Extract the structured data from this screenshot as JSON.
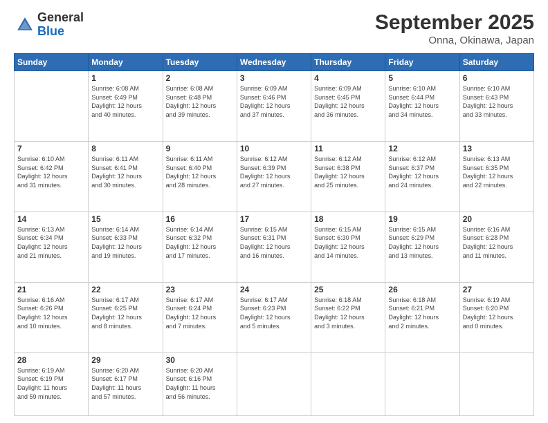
{
  "logo": {
    "general": "General",
    "blue": "Blue"
  },
  "header": {
    "month": "September 2025",
    "location": "Onna, Okinawa, Japan"
  },
  "weekdays": [
    "Sunday",
    "Monday",
    "Tuesday",
    "Wednesday",
    "Thursday",
    "Friday",
    "Saturday"
  ],
  "weeks": [
    [
      {
        "day": "",
        "info": ""
      },
      {
        "day": "1",
        "info": "Sunrise: 6:08 AM\nSunset: 6:49 PM\nDaylight: 12 hours\nand 40 minutes."
      },
      {
        "day": "2",
        "info": "Sunrise: 6:08 AM\nSunset: 6:48 PM\nDaylight: 12 hours\nand 39 minutes."
      },
      {
        "day": "3",
        "info": "Sunrise: 6:09 AM\nSunset: 6:46 PM\nDaylight: 12 hours\nand 37 minutes."
      },
      {
        "day": "4",
        "info": "Sunrise: 6:09 AM\nSunset: 6:45 PM\nDaylight: 12 hours\nand 36 minutes."
      },
      {
        "day": "5",
        "info": "Sunrise: 6:10 AM\nSunset: 6:44 PM\nDaylight: 12 hours\nand 34 minutes."
      },
      {
        "day": "6",
        "info": "Sunrise: 6:10 AM\nSunset: 6:43 PM\nDaylight: 12 hours\nand 33 minutes."
      }
    ],
    [
      {
        "day": "7",
        "info": "Sunrise: 6:10 AM\nSunset: 6:42 PM\nDaylight: 12 hours\nand 31 minutes."
      },
      {
        "day": "8",
        "info": "Sunrise: 6:11 AM\nSunset: 6:41 PM\nDaylight: 12 hours\nand 30 minutes."
      },
      {
        "day": "9",
        "info": "Sunrise: 6:11 AM\nSunset: 6:40 PM\nDaylight: 12 hours\nand 28 minutes."
      },
      {
        "day": "10",
        "info": "Sunrise: 6:12 AM\nSunset: 6:39 PM\nDaylight: 12 hours\nand 27 minutes."
      },
      {
        "day": "11",
        "info": "Sunrise: 6:12 AM\nSunset: 6:38 PM\nDaylight: 12 hours\nand 25 minutes."
      },
      {
        "day": "12",
        "info": "Sunrise: 6:12 AM\nSunset: 6:37 PM\nDaylight: 12 hours\nand 24 minutes."
      },
      {
        "day": "13",
        "info": "Sunrise: 6:13 AM\nSunset: 6:35 PM\nDaylight: 12 hours\nand 22 minutes."
      }
    ],
    [
      {
        "day": "14",
        "info": "Sunrise: 6:13 AM\nSunset: 6:34 PM\nDaylight: 12 hours\nand 21 minutes."
      },
      {
        "day": "15",
        "info": "Sunrise: 6:14 AM\nSunset: 6:33 PM\nDaylight: 12 hours\nand 19 minutes."
      },
      {
        "day": "16",
        "info": "Sunrise: 6:14 AM\nSunset: 6:32 PM\nDaylight: 12 hours\nand 17 minutes."
      },
      {
        "day": "17",
        "info": "Sunrise: 6:15 AM\nSunset: 6:31 PM\nDaylight: 12 hours\nand 16 minutes."
      },
      {
        "day": "18",
        "info": "Sunrise: 6:15 AM\nSunset: 6:30 PM\nDaylight: 12 hours\nand 14 minutes."
      },
      {
        "day": "19",
        "info": "Sunrise: 6:15 AM\nSunset: 6:29 PM\nDaylight: 12 hours\nand 13 minutes."
      },
      {
        "day": "20",
        "info": "Sunrise: 6:16 AM\nSunset: 6:28 PM\nDaylight: 12 hours\nand 11 minutes."
      }
    ],
    [
      {
        "day": "21",
        "info": "Sunrise: 6:16 AM\nSunset: 6:26 PM\nDaylight: 12 hours\nand 10 minutes."
      },
      {
        "day": "22",
        "info": "Sunrise: 6:17 AM\nSunset: 6:25 PM\nDaylight: 12 hours\nand 8 minutes."
      },
      {
        "day": "23",
        "info": "Sunrise: 6:17 AM\nSunset: 6:24 PM\nDaylight: 12 hours\nand 7 minutes."
      },
      {
        "day": "24",
        "info": "Sunrise: 6:17 AM\nSunset: 6:23 PM\nDaylight: 12 hours\nand 5 minutes."
      },
      {
        "day": "25",
        "info": "Sunrise: 6:18 AM\nSunset: 6:22 PM\nDaylight: 12 hours\nand 3 minutes."
      },
      {
        "day": "26",
        "info": "Sunrise: 6:18 AM\nSunset: 6:21 PM\nDaylight: 12 hours\nand 2 minutes."
      },
      {
        "day": "27",
        "info": "Sunrise: 6:19 AM\nSunset: 6:20 PM\nDaylight: 12 hours\nand 0 minutes."
      }
    ],
    [
      {
        "day": "28",
        "info": "Sunrise: 6:19 AM\nSunset: 6:19 PM\nDaylight: 11 hours\nand 59 minutes."
      },
      {
        "day": "29",
        "info": "Sunrise: 6:20 AM\nSunset: 6:17 PM\nDaylight: 11 hours\nand 57 minutes."
      },
      {
        "day": "30",
        "info": "Sunrise: 6:20 AM\nSunset: 6:16 PM\nDaylight: 11 hours\nand 56 minutes."
      },
      {
        "day": "",
        "info": ""
      },
      {
        "day": "",
        "info": ""
      },
      {
        "day": "",
        "info": ""
      },
      {
        "day": "",
        "info": ""
      }
    ]
  ]
}
